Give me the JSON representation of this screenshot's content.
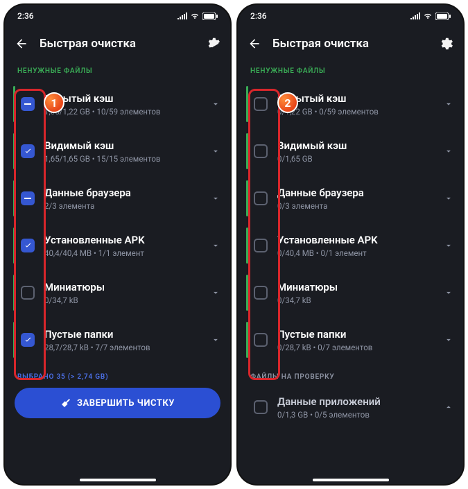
{
  "status": {
    "time": "2:36"
  },
  "header": {
    "title": "Быстрая очистка"
  },
  "section1": {
    "label": "НЕНУЖНЫЕ ФАЙЛЫ"
  },
  "left": {
    "items": [
      {
        "title": "Скрытый кэш",
        "sub": "1,05/1,22 GB • 10/59 элементов",
        "state": "partial"
      },
      {
        "title": "Видимый кэш",
        "sub": "1,65/1,65 GB • 15/15 элементов",
        "state": "checked"
      },
      {
        "title": "Данные браузера",
        "sub": "2/3 элемента",
        "state": "partial"
      },
      {
        "title": "Установленные APK",
        "sub": "40,4/40,4 MB • 1/1 элемент",
        "state": "checked"
      },
      {
        "title": "Миниатюры",
        "sub": "0/34,7 kB",
        "state": "empty"
      },
      {
        "title": "Пустые папки",
        "sub": "28,7/28,7 kB • 7/7 элементов",
        "state": "checked"
      }
    ],
    "footer_label": "ВЫБРАНО 35 (> 2,74 GB)",
    "cta": "ЗАВЕРШИТЬ ЧИСТКУ"
  },
  "right": {
    "items": [
      {
        "title": "Скрытый кэш",
        "sub": "0/1,22 GB • 0/59 элементов",
        "state": "empty"
      },
      {
        "title": "Видимый кэш",
        "sub": "0/1,65 GB",
        "state": "empty"
      },
      {
        "title": "Данные браузера",
        "sub": "0/3 элемента",
        "state": "empty"
      },
      {
        "title": "Установленные APK",
        "sub": "0/40,4 MB • 0/1 элемент",
        "state": "empty"
      },
      {
        "title": "Миниатюры",
        "sub": "0/34,7 kB",
        "state": "empty"
      },
      {
        "title": "Пустые папки",
        "sub": "0/28,7 kB • 0/7 элементов",
        "state": "empty"
      }
    ],
    "section2_label": "ФАЙЛЫ НА ПРОВЕРКУ",
    "extra": {
      "title": "Данные приложений",
      "sub": "0/1,3 GB • 0/5 элементов"
    }
  },
  "markers": {
    "m1": "1",
    "m2": "2"
  }
}
